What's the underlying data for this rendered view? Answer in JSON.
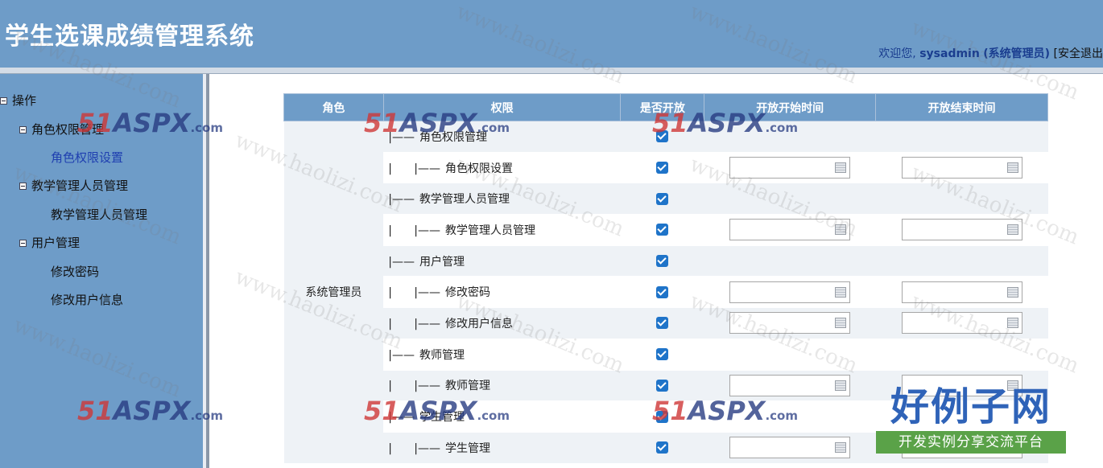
{
  "header": {
    "app_title": "学生选课成绩管理系统",
    "welcome_prefix": "欢迎您,",
    "username": "sysadmin",
    "role": "(系统管理员)",
    "logout": "[安全退出"
  },
  "sidebar": {
    "root_label": "操作",
    "groups": [
      {
        "label": "角色权限管理",
        "items": [
          {
            "label": "角色权限设置"
          }
        ]
      },
      {
        "label": "教学管理人员管理",
        "items": [
          {
            "label": "教学管理人员管理"
          }
        ]
      },
      {
        "label": "用户管理",
        "items": [
          {
            "label": "修改密码"
          },
          {
            "label": "修改用户信息"
          }
        ]
      }
    ]
  },
  "grid": {
    "columns": [
      "角色",
      "权限",
      "是否开放",
      "开放开始时间",
      "开放结束时间"
    ],
    "role_name": "系统管理员",
    "rows": [
      {
        "prefix": "|——",
        "label": "角色权限管理",
        "checked": true,
        "has_dates": false
      },
      {
        "prefix": "|——",
        "label": "角色权限设置",
        "checked": true,
        "has_dates": true
      },
      {
        "prefix": "|——",
        "label": "教学管理人员管理",
        "checked": true,
        "has_dates": false
      },
      {
        "prefix": "|——",
        "label": "教学管理人员管理",
        "checked": true,
        "has_dates": true
      },
      {
        "prefix": "|——",
        "label": "用户管理",
        "checked": true,
        "has_dates": false
      },
      {
        "prefix": "|——",
        "label": "修改密码",
        "checked": true,
        "has_dates": true
      },
      {
        "prefix": "|——",
        "label": "修改用户信息",
        "checked": true,
        "has_dates": true
      },
      {
        "prefix": "|——",
        "label": "教师管理",
        "checked": true,
        "has_dates": false
      },
      {
        "prefix": "|——",
        "label": "教师管理",
        "checked": true,
        "has_dates": true
      },
      {
        "prefix": "|——",
        "label": "学生管理",
        "checked": true,
        "has_dates": false
      },
      {
        "prefix": "|——",
        "label": "学生管理",
        "checked": true,
        "has_dates": true
      }
    ],
    "child_pipe": "|"
  },
  "watermarks": {
    "site": "www.haolizi.com",
    "aspx_num": "51",
    "aspx_word": "ASPX",
    "aspx_com": ".com",
    "brand_big": "好例子网",
    "brand_small": "开发实例分享交流平台"
  },
  "colors": {
    "header_bg": "#6e9cc8",
    "checkbox": "#1f74c9",
    "row_alt": "#eef2f6"
  }
}
